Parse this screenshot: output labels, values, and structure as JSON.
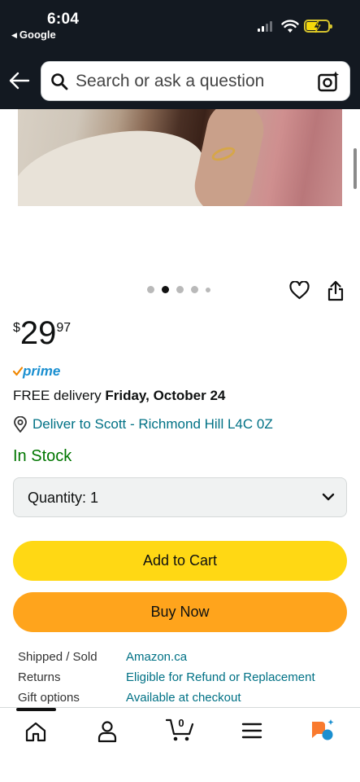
{
  "status_bar": {
    "time": "6:04",
    "back_app": "Google"
  },
  "header": {
    "search_placeholder": "Search or ask a question"
  },
  "gallery": {
    "dot_count": 5,
    "active_index": 1
  },
  "product": {
    "price_currency": "$",
    "price_whole": "29",
    "price_fraction": "97",
    "prime_label": "prime",
    "delivery_prefix": "FREE delivery ",
    "delivery_date": "Friday, October 24",
    "deliver_to": "Deliver to Scott - Richmond Hill L4C 0Z",
    "stock": "In Stock",
    "quantity_label": "Quantity: 1"
  },
  "buttons": {
    "add_to_cart": "Add to Cart",
    "buy_now": "Buy Now"
  },
  "info": [
    {
      "key": "Shipped / Sold",
      "value": "Amazon.ca"
    },
    {
      "key": "Returns",
      "value": "Eligible for Refund or Replacement"
    },
    {
      "key": "Gift options",
      "value": "Available at checkout"
    }
  ],
  "bottom_nav": {
    "cart_count": "0"
  },
  "colors": {
    "header_bg": "#131921",
    "add_to_cart": "#ffd814",
    "buy_now": "#ffa41c",
    "link": "#007185",
    "in_stock": "#007600",
    "prime": "#1a8fd0"
  }
}
